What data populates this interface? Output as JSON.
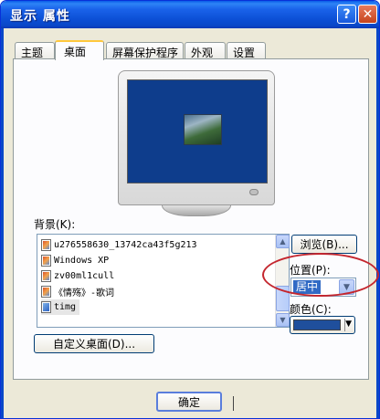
{
  "window": {
    "title": "显示 属性",
    "help_label": "?",
    "close_label": "✕"
  },
  "tabs": [
    {
      "label": "主题",
      "active": false
    },
    {
      "label": "桌面",
      "active": true
    },
    {
      "label": "屏幕保护程序",
      "active": false
    },
    {
      "label": "外观",
      "active": false
    },
    {
      "label": "设置",
      "active": false
    }
  ],
  "background": {
    "label": "背景(K):",
    "items": [
      {
        "name": "u276558630_13742ca43f5g213",
        "icon": "jpeg-file-icon"
      },
      {
        "name": "Windows XP",
        "icon": "jpeg-file-icon"
      },
      {
        "name": "zv00ml1cull",
        "icon": "jpeg-file-icon"
      },
      {
        "name": "《情殇》-歌词",
        "icon": "jpeg-file-icon"
      },
      {
        "name": "timg",
        "icon": "bitmap-file-icon",
        "selected": true
      }
    ]
  },
  "buttons": {
    "browse": "浏览(B)...",
    "customize": "自定义桌面(D)...",
    "ok": "确定"
  },
  "position": {
    "label": "位置(P):",
    "value": "居中"
  },
  "color": {
    "label": "颜色(C):",
    "value": "#1f4f9c"
  },
  "colors": {
    "titlebar": "#0a48c8",
    "desktop_preview": "#0e3d8c",
    "highlight_annotation": "#c4262e"
  }
}
